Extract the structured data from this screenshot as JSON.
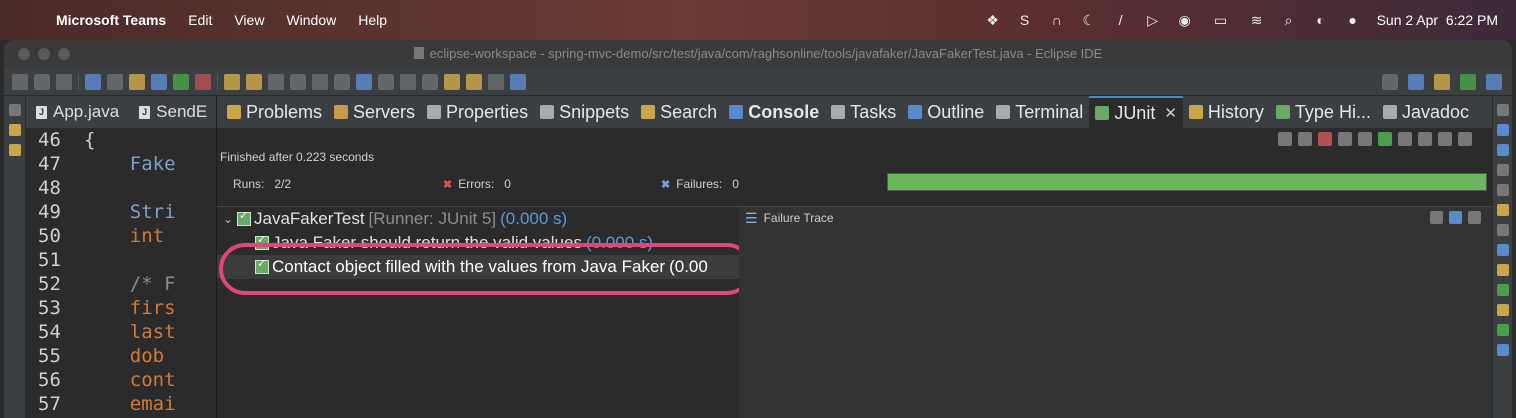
{
  "menubar": {
    "apple_icon": "apple-logo",
    "app_name": "Microsoft Teams",
    "items": [
      "Edit",
      "View",
      "Window",
      "Help"
    ],
    "date_time": "Sun 2 Apr  6:22 PM"
  },
  "window": {
    "title": "eclipse-workspace - spring-mvc-demo/src/test/java/com/raghsonline/tools/javafaker/JavaFakerTest.java - Eclipse IDE"
  },
  "editor": {
    "tabs": [
      "App.java",
      "SendE"
    ],
    "lines": [
      {
        "num": "46",
        "text": "{"
      },
      {
        "num": "47",
        "text": "    Fake"
      },
      {
        "num": "48",
        "text": ""
      },
      {
        "num": "49",
        "text": "    Stri"
      },
      {
        "num": "50",
        "text": "    int"
      },
      {
        "num": "51",
        "text": ""
      },
      {
        "num": "52",
        "text": "    /* F"
      },
      {
        "num": "53",
        "text": "    firs"
      },
      {
        "num": "54",
        "text": "    last"
      },
      {
        "num": "55",
        "text": "    dob"
      },
      {
        "num": "56",
        "text": "    cont"
      },
      {
        "num": "57",
        "text": "    emai"
      }
    ]
  },
  "views": {
    "tabs": [
      "Problems",
      "Servers",
      "Properties",
      "Snippets",
      "Search",
      "Console",
      "Tasks",
      "Outline",
      "Terminal",
      "JUnit",
      "History",
      "Type Hi...",
      "Javadoc"
    ],
    "active_tab": "JUnit"
  },
  "junit": {
    "finished": "Finished after 0.223 seconds",
    "runs_label": "Runs:",
    "runs_value": "2/2",
    "errors_label": "Errors:",
    "errors_value": "0",
    "failures_label": "Failures:",
    "failures_value": "0",
    "progress": 1.0,
    "progress_color": "#6bb85c",
    "tree": {
      "root_name": "JavaFakerTest",
      "root_meta": "[Runner: JUnit 5]",
      "root_time": "(0.000 s)",
      "tests": [
        {
          "name": "Java Faker should return the valid values",
          "time": "(0.000 s)"
        },
        {
          "name": "Contact object filled with the values from Java Faker",
          "time": "(0.00"
        }
      ]
    },
    "failure_trace_label": "Failure Trace",
    "highlight_color": "#e0457b"
  }
}
